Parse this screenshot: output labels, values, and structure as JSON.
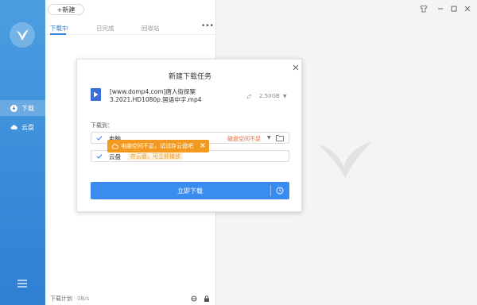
{
  "toolbar": {
    "new_task_label": "+新建"
  },
  "tabs": [
    {
      "label": "下载中",
      "active": true
    },
    {
      "label": "已完成",
      "active": false
    },
    {
      "label": "回收站",
      "active": false
    }
  ],
  "tab_more_label": "•••",
  "sidebar": {
    "items": [
      {
        "label": "下载",
        "icon": "download-icon",
        "active": true
      },
      {
        "label": "云盘",
        "icon": "cloud-icon",
        "active": false
      }
    ]
  },
  "footer": {
    "plan_label": "下载计划",
    "speed": "0B/s"
  },
  "dialog": {
    "title": "新建下载任务",
    "file_name": "[www.domp4.com]唐人街探案3.2021.HD1080p.国语中字.mp4",
    "file_size": "2.50GB",
    "save_to_label": "下载到：",
    "local_label": "电脑",
    "local_warning": "磁盘空间不足",
    "cloud_label": "云盘",
    "cloud_hint": "存云盘，可立即播放",
    "tooltip_text": "电脑空间不足，试试存云盘吧",
    "download_button": "立即下载"
  },
  "colors": {
    "brand_blue": "#3b8cf0",
    "warning_orange": "#f29a1f",
    "warning_text": "#e8663b"
  }
}
